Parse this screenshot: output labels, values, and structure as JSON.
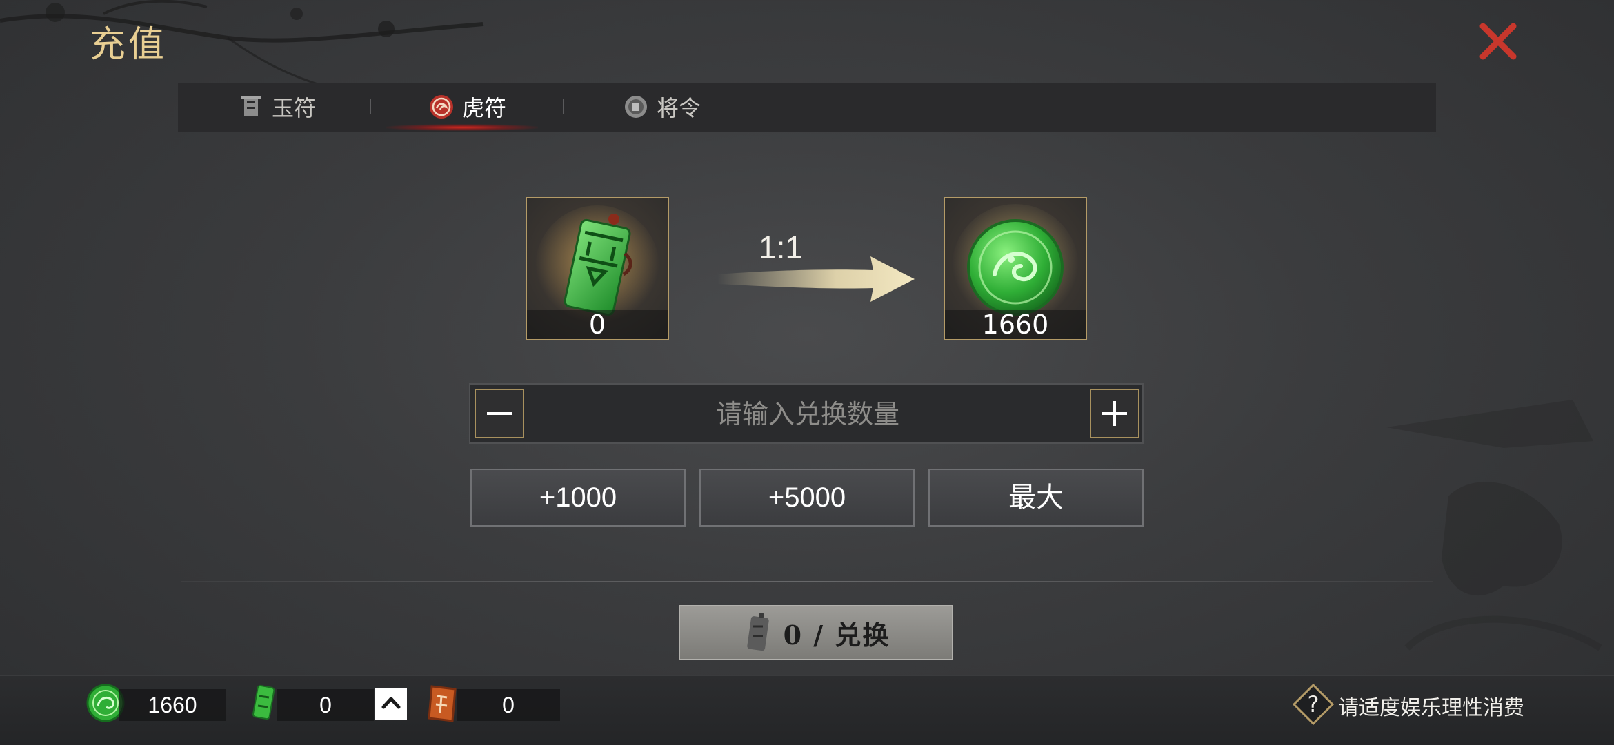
{
  "header": {
    "title": "充值"
  },
  "tabs": [
    {
      "label": "玉符",
      "icon": "jade-tally-icon",
      "active": false
    },
    {
      "label": "虎符",
      "icon": "tiger-tally-icon",
      "active": true
    },
    {
      "label": "将令",
      "icon": "general-order-icon",
      "active": false
    }
  ],
  "conversion": {
    "source": {
      "icon": "green-tally-icon",
      "count": "0"
    },
    "ratio": "1:1",
    "target": {
      "icon": "jade-coin-icon",
      "count": "1660"
    }
  },
  "quantity": {
    "placeholder": "请输入兑换数量",
    "value": ""
  },
  "quick_buttons": [
    "+1000",
    "+5000",
    "最大"
  ],
  "exchange": {
    "label": "0 / 兑换"
  },
  "resources": [
    {
      "icon": "jade-coin-icon",
      "value": "1660"
    },
    {
      "icon": "green-tally-icon",
      "value": "0"
    },
    {
      "icon": "general-seal-icon",
      "value": "0"
    }
  ],
  "notice": "请适度娱乐理性消费",
  "colors": {
    "accent_gold": "#e9cf93",
    "close_red": "#c8372c",
    "active_tab_glow": "#dc281e"
  }
}
